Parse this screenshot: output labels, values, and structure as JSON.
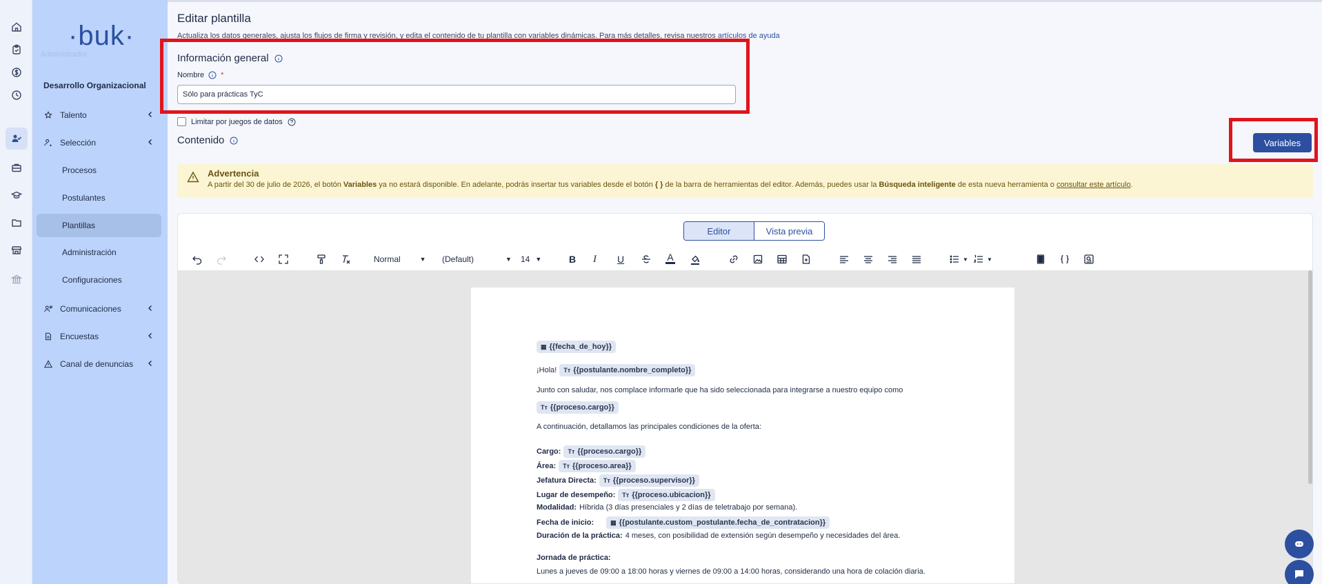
{
  "rail": {
    "icons": [
      "home-icon",
      "clipboard-icon",
      "dollar-icon",
      "clock-icon",
      "people-icon",
      "briefcase-icon",
      "graduation-cap-icon",
      "folder-icon",
      "store-icon",
      "bank-icon"
    ]
  },
  "sidebar": {
    "logo": "·buk·",
    "logo_sub": "Administrador",
    "section": "Desarrollo Organizacional",
    "items": [
      {
        "label": "Talento",
        "icon": "star-icon"
      },
      {
        "label": "Selección",
        "icon": "user-search-icon"
      },
      {
        "label": "Comunicaciones",
        "icon": "user-chat-icon"
      },
      {
        "label": "Encuestas",
        "icon": "document-icon"
      },
      {
        "label": "Canal de denuncias",
        "icon": "alert-triangle-icon"
      }
    ],
    "subitems": [
      "Procesos",
      "Postulantes",
      "Plantillas",
      "Administración",
      "Configuraciones"
    ],
    "active_subitem": "Plantillas"
  },
  "main": {
    "title": "Editar plantilla",
    "desc_text": "Actualiza los datos generales, ajusta los flujos de firma y revisión, y edita el contenido de tu plantilla con variables dinámicas. Para más detalles, revisa nuestros ",
    "desc_link": "artículos de ayuda",
    "general_title": "Información general",
    "name_label": "Nombre",
    "name_required": "*",
    "name_value": "Sólo para prácticas TyC",
    "limit_label": "Limitar por juegos de datos",
    "content_title": "Contenido",
    "variables_button": "Variables",
    "warning": {
      "title": "Advertencia",
      "t1": "A partir del 30 de julio de 2026, el botón ",
      "b1": "Variables",
      "t2": " ya no estará disponible. En adelante, podrás insertar tus variables desde el botón ",
      "b2": "{ }",
      "t3": " de la barra de herramientas del editor. Además, puedes usar la ",
      "b3": "Búsqueda inteligente",
      "t4": " de esta nueva herramienta o ",
      "link": "consultar este artículo",
      "t5": "."
    }
  },
  "editor": {
    "tab_editor": "Editor",
    "tab_preview": "Vista previa",
    "style_select": "Normal",
    "font_select": "(Default)",
    "size_select": "14",
    "bold": "B",
    "italic": "I",
    "underline": "U",
    "font_color": "A"
  },
  "doc": {
    "date_chip": "{{fecha_de_hoy}}",
    "greeting": "¡Hola!",
    "name_chip": "{{postulante.nombre_completo}}",
    "intro": "Junto con saludar, nos complace informarle que ha sido seleccionada para integrarse a nuestro equipo como",
    "cargo_chip": "{{proceso.cargo}}",
    "cont": "A continuación, detallamos las principales condiciones de la oferta:",
    "l_cargo": "Cargo:",
    "v_cargo": "{{proceso.cargo}}",
    "l_area": "Área:",
    "v_area": "{{proceso.area}}",
    "l_jefe": "Jefatura Directa:",
    "v_jefe": "{{proceso.supervisor}}",
    "l_lugar": "Lugar de desempeño:",
    "v_lugar": "{{proceso.ubicacion}}",
    "l_modalidad": "Modalidad:",
    "v_modalidad": "Híbrida (3 días presenciales y 2 días de teletrabajo por semana).",
    "l_inicio": "Fecha de inicio:",
    "v_inicio": "{{postulante.custom_postulante.fecha_de_contratacion}}",
    "l_duracion": "Duración de la práctica:",
    "v_duracion": "4 meses, con posibilidad de extensión según desempeño y necesidades del área.",
    "l_jornada": "Jornada de práctica:",
    "v_jornada": "Lunes a jueves de 09:00 a 18:00 horas y viernes de 09:00 a 14:00 horas, considerando una hora de colación diaria.",
    "chip_text_icon": "Tт",
    "chip_date_icon": "▦"
  },
  "colors": {
    "brand": "#2d4fa0",
    "sidebar": "#bcd4fb",
    "highlight_box": "#e0141c",
    "warning_bg": "#fbf5d3"
  }
}
